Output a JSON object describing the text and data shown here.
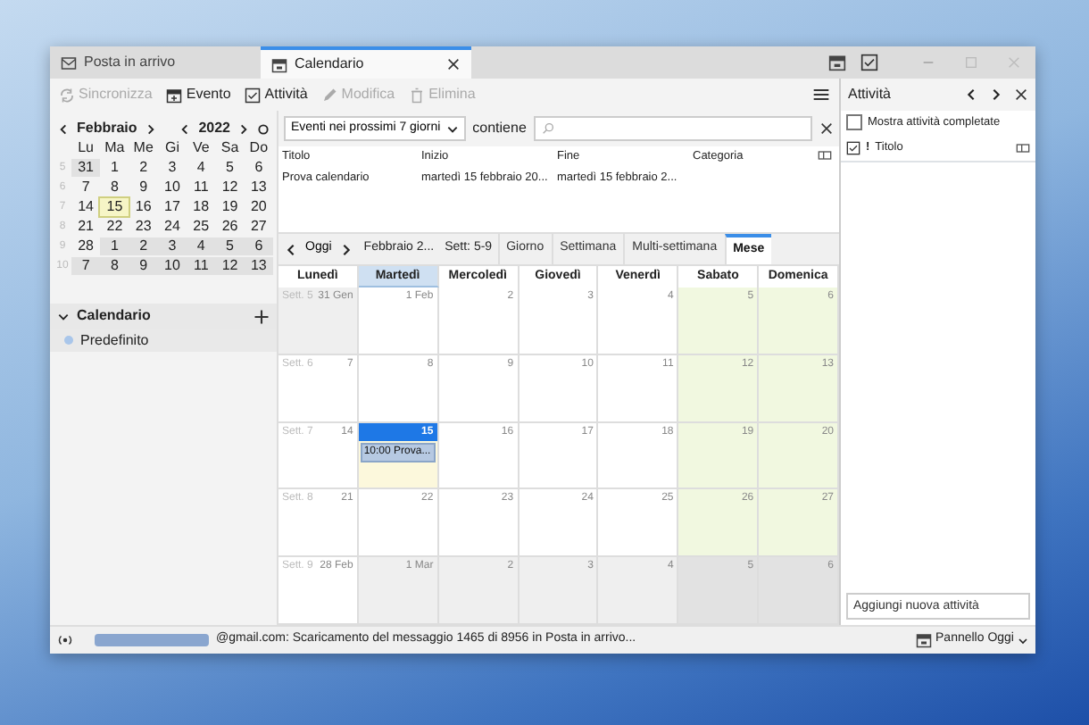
{
  "tabs": [
    {
      "label": "Posta in arrivo",
      "kind": "mail",
      "selected": false
    },
    {
      "label": "Calendario",
      "kind": "calendar",
      "selected": true
    }
  ],
  "toolbar": [
    {
      "label": "Sincronizza",
      "kind": "sync",
      "disabled": true
    },
    {
      "label": "Evento",
      "kind": "event",
      "disabled": false
    },
    {
      "label": "Attività",
      "kind": "task",
      "disabled": false
    },
    {
      "label": "Modifica",
      "kind": "edit",
      "disabled": true
    },
    {
      "label": "Elimina",
      "kind": "delete",
      "disabled": true
    }
  ],
  "minimonth": {
    "month": "Febbraio",
    "year": "2022",
    "weekdays": [
      "Lu",
      "Ma",
      "Me",
      "Gi",
      "Ve",
      "Sa",
      "Do"
    ],
    "weeks": [
      {
        "number": "5",
        "days": [
          {
            "day": "31",
            "other": true,
            "today": false
          },
          {
            "day": "1",
            "other": false,
            "today": false
          },
          {
            "day": "2",
            "other": false,
            "today": false
          },
          {
            "day": "3",
            "other": false,
            "today": false
          },
          {
            "day": "4",
            "other": false,
            "today": false
          },
          {
            "day": "5",
            "other": false,
            "today": false
          },
          {
            "day": "6",
            "other": false,
            "today": false
          }
        ]
      },
      {
        "number": "6",
        "days": [
          {
            "day": "7",
            "other": false,
            "today": false
          },
          {
            "day": "8",
            "other": false,
            "today": false
          },
          {
            "day": "9",
            "other": false,
            "today": false
          },
          {
            "day": "10",
            "other": false,
            "today": false
          },
          {
            "day": "11",
            "other": false,
            "today": false
          },
          {
            "day": "12",
            "other": false,
            "today": false
          },
          {
            "day": "13",
            "other": false,
            "today": false
          }
        ]
      },
      {
        "number": "7",
        "days": [
          {
            "day": "14",
            "other": false,
            "today": false
          },
          {
            "day": "15",
            "other": false,
            "today": true
          },
          {
            "day": "16",
            "other": false,
            "today": false
          },
          {
            "day": "17",
            "other": false,
            "today": false
          },
          {
            "day": "18",
            "other": false,
            "today": false
          },
          {
            "day": "19",
            "other": false,
            "today": false
          },
          {
            "day": "20",
            "other": false,
            "today": false
          }
        ]
      },
      {
        "number": "8",
        "days": [
          {
            "day": "21",
            "other": false,
            "today": false
          },
          {
            "day": "22",
            "other": false,
            "today": false
          },
          {
            "day": "23",
            "other": false,
            "today": false
          },
          {
            "day": "24",
            "other": false,
            "today": false
          },
          {
            "day": "25",
            "other": false,
            "today": false
          },
          {
            "day": "26",
            "other": false,
            "today": false
          },
          {
            "day": "27",
            "other": false,
            "today": false
          }
        ]
      },
      {
        "number": "9",
        "days": [
          {
            "day": "28",
            "other": false,
            "today": false
          },
          {
            "day": "1",
            "other": true,
            "today": false
          },
          {
            "day": "2",
            "other": true,
            "today": false
          },
          {
            "day": "3",
            "other": true,
            "today": false
          },
          {
            "day": "4",
            "other": true,
            "today": false
          },
          {
            "day": "5",
            "other": true,
            "today": false
          },
          {
            "day": "6",
            "other": true,
            "today": false
          }
        ]
      },
      {
        "number": "10",
        "days": [
          {
            "day": "7",
            "other": true,
            "today": false
          },
          {
            "day": "8",
            "other": true,
            "today": false
          },
          {
            "day": "9",
            "other": true,
            "today": false
          },
          {
            "day": "10",
            "other": true,
            "today": false
          },
          {
            "day": "11",
            "other": true,
            "today": false
          },
          {
            "day": "12",
            "other": true,
            "today": false
          },
          {
            "day": "13",
            "other": true,
            "today": false
          }
        ]
      }
    ]
  },
  "calendars": {
    "title": "Calendario",
    "expanded": true,
    "items": [
      {
        "name": "Predefinito",
        "color": "#a9c6ea"
      }
    ]
  },
  "filter": {
    "range": "Eventi nei prossimi 7 giorni",
    "contains_label": "contiene"
  },
  "event_list": {
    "columns": [
      "Titolo",
      "Inizio",
      "Fine",
      "Categoria"
    ],
    "rows": [
      {
        "title": "Prova calendario",
        "start": "martedì 15 febbraio 20...",
        "end": "martedì 15 febbraio 2..."
      }
    ]
  },
  "navigation": {
    "today": "Oggi",
    "period": "Febbraio 2...",
    "week": "Sett: 5-9",
    "views": [
      {
        "label": "Giorno",
        "selected": false
      },
      {
        "label": "Settimana",
        "selected": false
      },
      {
        "label": "Multi-settimana",
        "selected": false
      },
      {
        "label": "Mese",
        "selected": true
      }
    ]
  },
  "month": {
    "columns": [
      {
        "label": "Lunedì",
        "selected": false,
        "weekend": false
      },
      {
        "label": "Martedì",
        "selected": true,
        "weekend": false
      },
      {
        "label": "Mercoledì",
        "selected": false,
        "weekend": false
      },
      {
        "label": "Giovedì",
        "selected": false,
        "weekend": false
      },
      {
        "label": "Venerdì",
        "selected": false,
        "weekend": false
      },
      {
        "label": "Sabato",
        "selected": false,
        "weekend": true
      },
      {
        "label": "Domenica",
        "selected": false,
        "weekend": true
      }
    ],
    "weeks": [
      {
        "label": "Sett. 5",
        "days": [
          {
            "label": "31 Gen",
            "other": true,
            "today": false
          },
          {
            "label": "1 Feb",
            "other": false,
            "today": false
          },
          {
            "label": "2",
            "other": false,
            "today": false
          },
          {
            "label": "3",
            "other": false,
            "today": false
          },
          {
            "label": "4",
            "other": false,
            "today": false
          },
          {
            "label": "5",
            "other": false,
            "today": false
          },
          {
            "label": "6",
            "other": false,
            "today": false
          }
        ]
      },
      {
        "label": "Sett. 6",
        "days": [
          {
            "label": "7",
            "other": false,
            "today": false
          },
          {
            "label": "8",
            "other": false,
            "today": false
          },
          {
            "label": "9",
            "other": false,
            "today": false
          },
          {
            "label": "10",
            "other": false,
            "today": false
          },
          {
            "label": "11",
            "other": false,
            "today": false
          },
          {
            "label": "12",
            "other": false,
            "today": false
          },
          {
            "label": "13",
            "other": false,
            "today": false
          }
        ]
      },
      {
        "label": "Sett. 7",
        "days": [
          {
            "label": "14",
            "other": false,
            "today": false
          },
          {
            "label": "15",
            "other": false,
            "today": true,
            "events": [
              "10:00 Prova..."
            ]
          },
          {
            "label": "16",
            "other": false,
            "today": false
          },
          {
            "label": "17",
            "other": false,
            "today": false
          },
          {
            "label": "18",
            "other": false,
            "today": false
          },
          {
            "label": "19",
            "other": false,
            "today": false
          },
          {
            "label": "20",
            "other": false,
            "today": false
          }
        ]
      },
      {
        "label": "Sett. 8",
        "days": [
          {
            "label": "21",
            "other": false,
            "today": false
          },
          {
            "label": "22",
            "other": false,
            "today": false
          },
          {
            "label": "23",
            "other": false,
            "today": false
          },
          {
            "label": "24",
            "other": false,
            "today": false
          },
          {
            "label": "25",
            "other": false,
            "today": false
          },
          {
            "label": "26",
            "other": false,
            "today": false
          },
          {
            "label": "27",
            "other": false,
            "today": false
          }
        ]
      },
      {
        "label": "Sett. 9",
        "days": [
          {
            "label": "28 Feb",
            "other": false,
            "today": false
          },
          {
            "label": "1 Mar",
            "other": true,
            "today": false
          },
          {
            "label": "2",
            "other": true,
            "today": false
          },
          {
            "label": "3",
            "other": true,
            "today": false
          },
          {
            "label": "4",
            "other": true,
            "today": false
          },
          {
            "label": "5",
            "other": true,
            "today": false
          },
          {
            "label": "6",
            "other": true,
            "today": false
          }
        ]
      }
    ]
  },
  "tasks": {
    "title": "Attività",
    "show_completed": {
      "label": "Mostra attività completate",
      "checked": false
    },
    "priority_column": "!",
    "columns": [
      "Titolo"
    ],
    "add_placeholder": "Aggiungi nuova attività"
  },
  "status": {
    "message": "@gmail.com: Scaricamento del messaggio 1465 di 8956 in Posta in arrivo...",
    "today_pane": "Pannello Oggi"
  }
}
